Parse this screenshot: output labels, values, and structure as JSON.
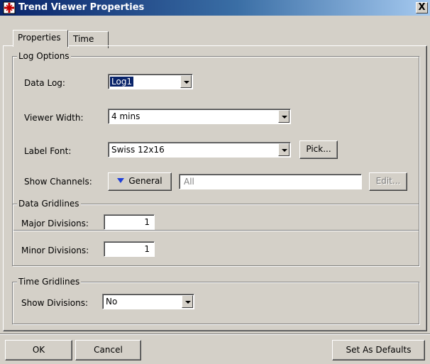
{
  "window": {
    "title": "Trend Viewer Properties",
    "close_label": "X",
    "title_icon": "trend-viewer-app-icon"
  },
  "tabs": [
    {
      "label": "Properties",
      "active": true
    },
    {
      "label": "Time",
      "active": false
    }
  ],
  "log_options": {
    "group_title": "Log Options",
    "data_log_label": "Data Log:",
    "data_log_value": "Log1",
    "viewer_width_label": "Viewer Width:",
    "viewer_width_value": "4 mins",
    "label_font_label": "Label Font:",
    "label_font_value": "Swiss 12x16",
    "pick_button": "Pick...",
    "show_channels_label": "Show Channels:",
    "channels_button": "General",
    "channels_value": "All",
    "edit_button": "Edit..."
  },
  "data_gridlines": {
    "group_title": "Data Gridlines",
    "major_label": "Major Divisions:",
    "major_value": "1",
    "minor_label": "Minor Divisions:",
    "minor_value": "1"
  },
  "time_gridlines": {
    "group_title": "Time Gridlines",
    "show_label": "Show Divisions:",
    "show_value": "No"
  },
  "footer": {
    "ok": "OK",
    "cancel": "Cancel",
    "defaults": "Set As Defaults"
  }
}
